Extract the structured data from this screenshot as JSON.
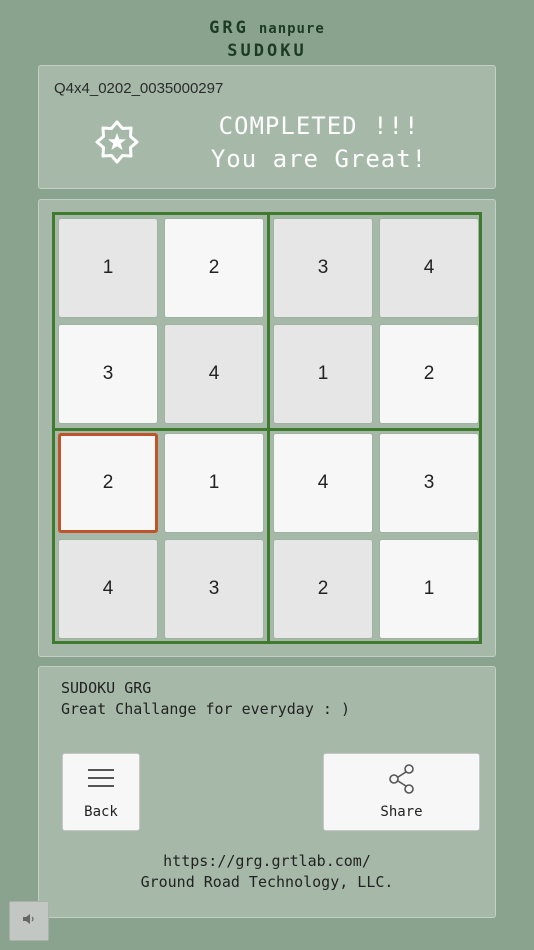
{
  "logo": {
    "line1_main": "GRG",
    "line1_sub": "nanpure",
    "line2": "SUDOKU"
  },
  "status": {
    "puzzle_id": "Q4x4_0202_0035000297",
    "completed_text": "COMPLETED !!!",
    "praise_text": "You are Great!",
    "badge_icon": "star-badge-icon"
  },
  "board": {
    "size": 4,
    "selected": {
      "row": 2,
      "col": 0
    },
    "cells": [
      [
        {
          "value": "1",
          "shade": "dark"
        },
        {
          "value": "2",
          "shade": "light"
        },
        {
          "value": "3",
          "shade": "dark"
        },
        {
          "value": "4",
          "shade": "dark"
        }
      ],
      [
        {
          "value": "3",
          "shade": "light"
        },
        {
          "value": "4",
          "shade": "dark"
        },
        {
          "value": "1",
          "shade": "dark"
        },
        {
          "value": "2",
          "shade": "light"
        }
      ],
      [
        {
          "value": "2",
          "shade": "light"
        },
        {
          "value": "1",
          "shade": "light"
        },
        {
          "value": "4",
          "shade": "light"
        },
        {
          "value": "3",
          "shade": "light"
        }
      ],
      [
        {
          "value": "4",
          "shade": "dark"
        },
        {
          "value": "3",
          "shade": "dark"
        },
        {
          "value": "2",
          "shade": "dark"
        },
        {
          "value": "1",
          "shade": "light"
        }
      ]
    ]
  },
  "info": {
    "title": "SUDOKU GRG",
    "subtitle": "Great Challange for everyday : )",
    "back_label": "Back",
    "back_icon": "hamburger-menu-icon",
    "share_label": "Share",
    "share_icon": "share-icon",
    "url": "https://grg.grtlab.com/",
    "company": "Ground Road Technology, LLC."
  },
  "sound": {
    "icon": "speaker-icon"
  },
  "colors": {
    "background": "#8aa38f",
    "panel": "#a6b9a8",
    "board_border": "#3f7a2f",
    "selected_border": "#c0532a",
    "logo_text": "#1d3b23"
  }
}
